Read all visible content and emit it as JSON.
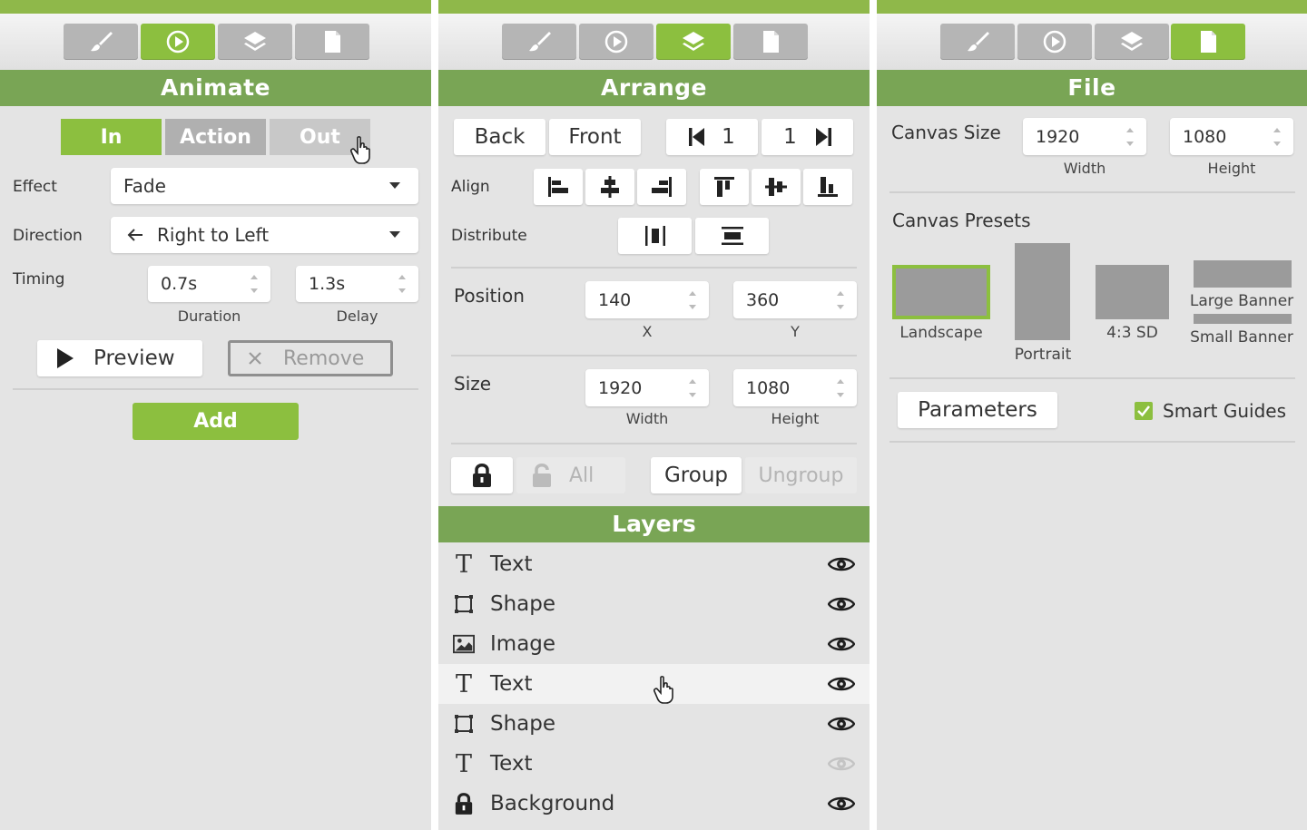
{
  "colors": {
    "accent": "#8cbf3f",
    "header": "#79a555",
    "topbar": "#8fb84a",
    "panel_bg": "#e4e4e4",
    "tab_inactive": "#b5b5b5"
  },
  "toolbar": {
    "icons": [
      "brush-icon",
      "play-icon",
      "layers-icon",
      "document-icon"
    ]
  },
  "animate": {
    "title": "Animate",
    "segments": [
      "In",
      "Action",
      "Out"
    ],
    "effect_label": "Effect",
    "effect_value": "Fade",
    "direction_label": "Direction",
    "direction_value": "Right to Left",
    "timing_label": "Timing",
    "duration_value": "0.7s",
    "duration_caption": "Duration",
    "delay_value": "1.3s",
    "delay_caption": "Delay",
    "preview_label": "Preview",
    "remove_label": "Remove",
    "add_label": "Add"
  },
  "arrange": {
    "title": "Arrange",
    "back_label": "Back",
    "front_label": "Front",
    "step_back_value": "1",
    "step_forward_value": "1",
    "align_label": "Align",
    "distribute_label": "Distribute",
    "position_label": "Position",
    "x_value": "140",
    "x_caption": "X",
    "y_value": "360",
    "y_caption": "Y",
    "size_label": "Size",
    "width_value": "1920",
    "width_caption": "Width",
    "height_value": "1080",
    "height_caption": "Height",
    "lock_all_label": "All",
    "group_label": "Group",
    "ungroup_label": "Ungroup"
  },
  "layers": {
    "title": "Layers",
    "items": [
      {
        "name": "Text",
        "icon": "text-icon",
        "visible": true
      },
      {
        "name": "Shape",
        "icon": "shape-icon",
        "visible": true
      },
      {
        "name": "Image",
        "icon": "image-icon",
        "visible": true
      },
      {
        "name": "Text",
        "icon": "text-icon",
        "visible": true,
        "hovered": true
      },
      {
        "name": "Shape",
        "icon": "shape-icon",
        "visible": true
      },
      {
        "name": "Text",
        "icon": "text-icon",
        "visible": false
      },
      {
        "name": "Background",
        "icon": "lock-icon",
        "visible": true
      }
    ]
  },
  "file": {
    "title": "File",
    "canvas_size_label": "Canvas Size",
    "width_value": "1920",
    "width_caption": "Width",
    "height_value": "1080",
    "height_caption": "Height",
    "presets_label": "Canvas Presets",
    "presets": [
      "Landscape",
      "Portrait",
      "4:3 SD",
      "Large Banner",
      "Small Banner"
    ],
    "parameters_label": "Parameters",
    "smart_guides_label": "Smart Guides",
    "smart_guides_checked": true
  }
}
